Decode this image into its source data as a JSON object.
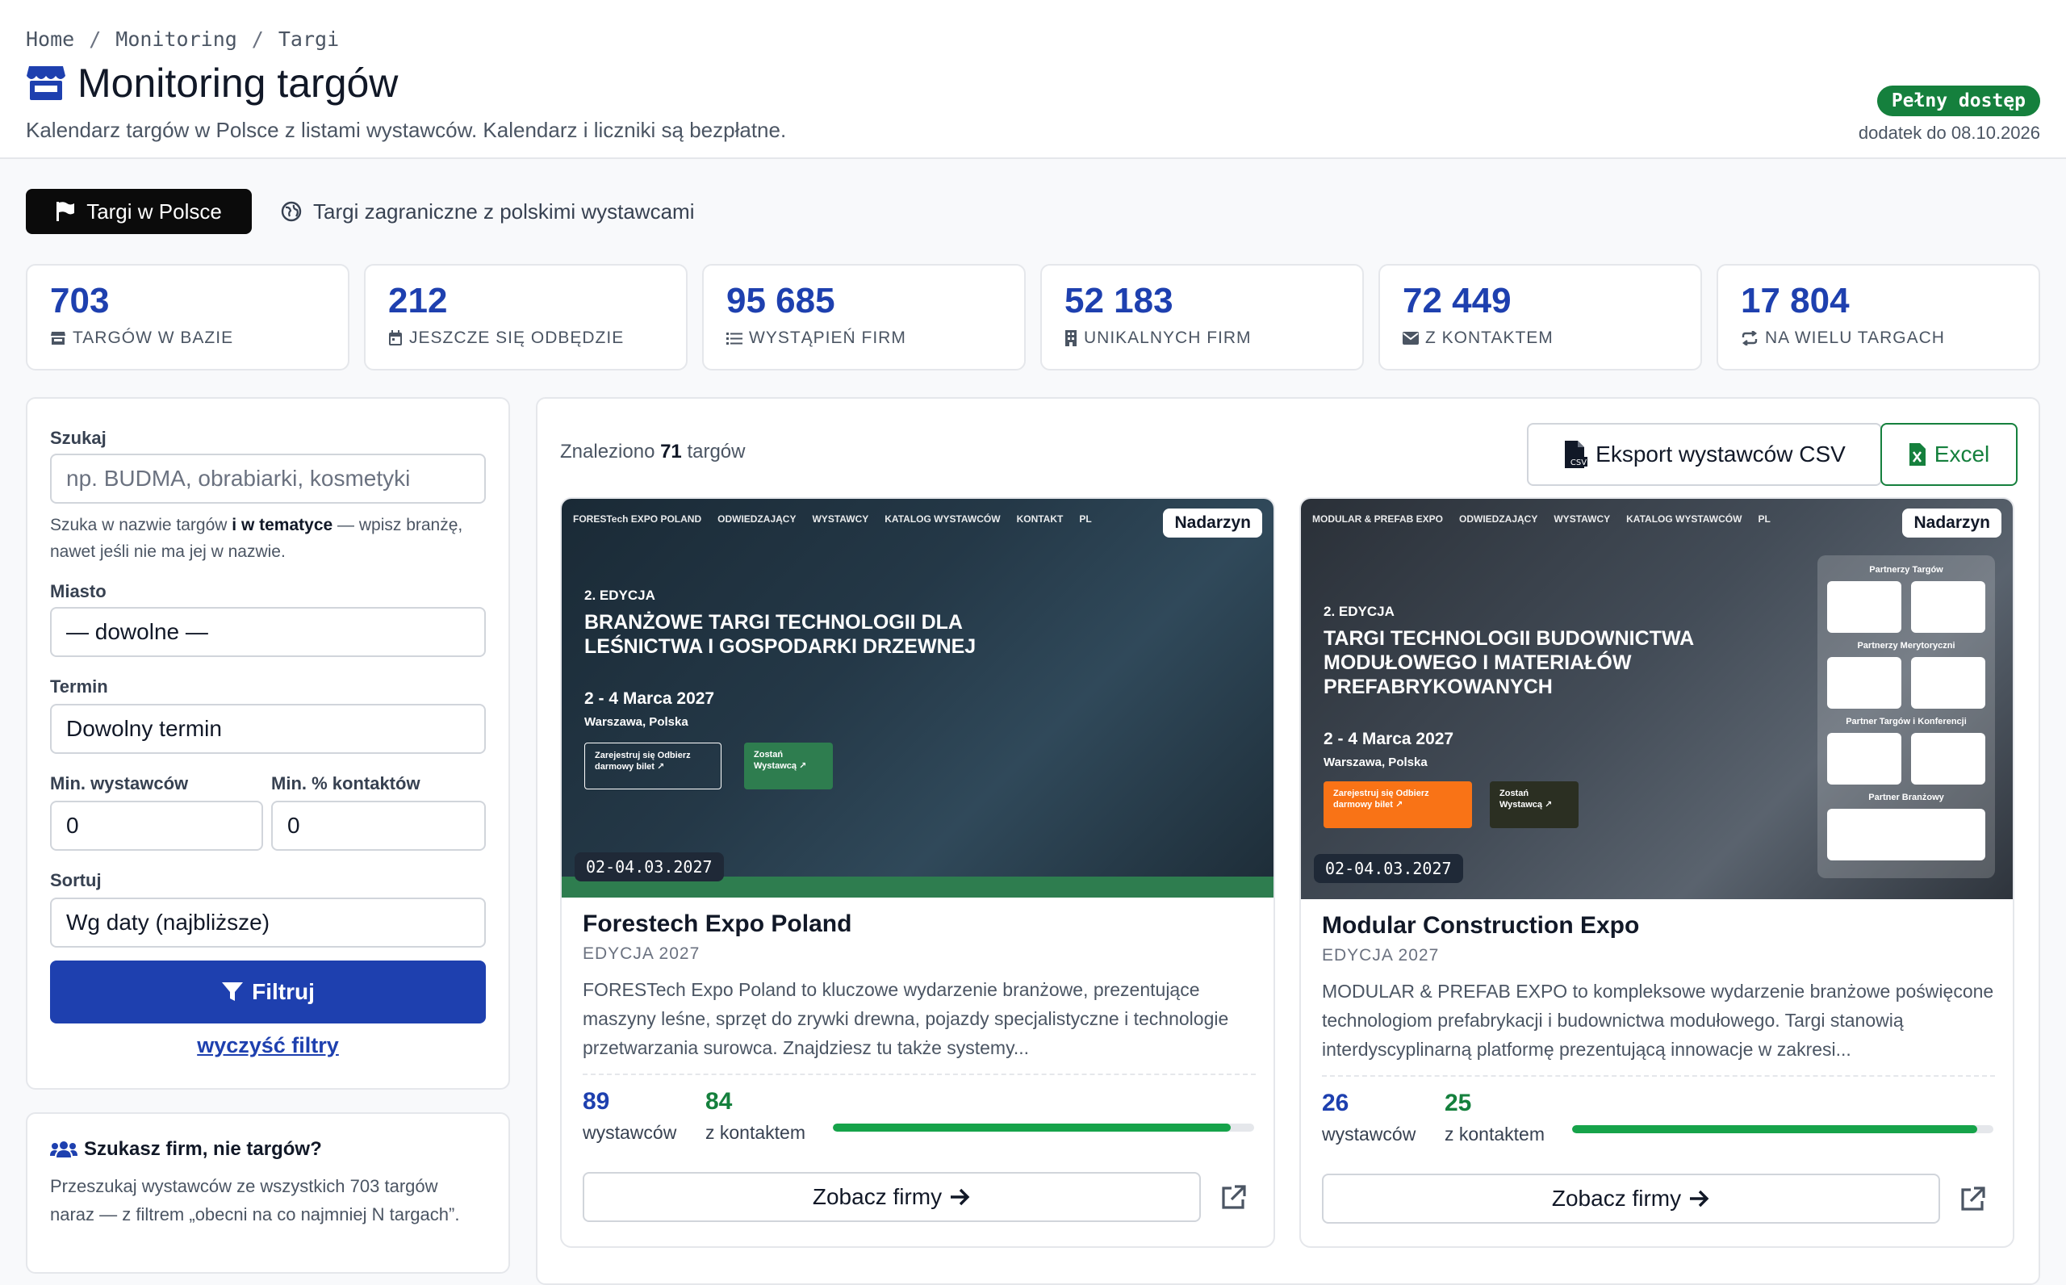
{
  "breadcrumb": [
    "Home",
    "Monitoring",
    "Targi"
  ],
  "header": {
    "title": "Monitoring targów",
    "subtitle": "Kalendarz targów w Polsce z listami wystawców. Kalendarz i liczniki są bezpłatne.",
    "badge": "Pełny dostęp",
    "badge_sub": "dodatek do 08.10.2026"
  },
  "tabs": {
    "active": "Targi w Polsce",
    "other": "Targi zagraniczne z polskimi wystawcami"
  },
  "stats": [
    {
      "value": "703",
      "label": "TARGÓW W BAZIE",
      "icon": "store-icon"
    },
    {
      "value": "212",
      "label": "JESZCZE SIĘ ODBĘDZIE",
      "icon": "calendar-icon"
    },
    {
      "value": "95 685",
      "label": "WYSTĄPIEŃ FIRM",
      "icon": "list-icon"
    },
    {
      "value": "52 183",
      "label": "UNIKALNYCH FIRM",
      "icon": "building-icon"
    },
    {
      "value": "72 449",
      "label": "Z KONTAKTEM",
      "icon": "envelope-icon"
    },
    {
      "value": "17 804",
      "label": "NA WIELU TARGACH",
      "icon": "repeat-icon"
    }
  ],
  "filters": {
    "search_label": "Szukaj",
    "search_placeholder": "np. BUDMA, obrabiarki, kosmetyki",
    "search_hint_1": "Szuka w nazwie targów ",
    "search_hint_bold": "i w tematyce",
    "search_hint_2": " — wpisz branżę, nawet jeśli nie ma jej w nazwie.",
    "city_label": "Miasto",
    "city_value": "— dowolne —",
    "term_label": "Termin",
    "term_value": "Dowolny termin",
    "min_exh_label": "Min. wystawców",
    "min_exh_value": "0",
    "min_contact_label": "Min. % kontaktów",
    "min_contact_value": "0",
    "sort_label": "Sortuj",
    "sort_value": "Wg daty (najbliższe)",
    "filter_button": "Filtruj",
    "clear_link": "wyczyść filtry"
  },
  "promo": {
    "title": "Szukasz firm, nie targów?",
    "text": "Przeszukaj wystawców ze wszystkich 703 targów naraz — z filtrem „obecni na co najmniej N targach”."
  },
  "results": {
    "found_prefix": "Znaleziono ",
    "found_count": "71",
    "found_suffix": " targów",
    "csv_button": "Eksport wystawców CSV",
    "excel_button": "Excel"
  },
  "cards": [
    {
      "city": "Nadarzyn",
      "date": "02-04.03.2027",
      "title": "Forestech Expo Poland",
      "edition": "EDYCJA 2027",
      "description": "FORESTech Expo Poland to kluczowe wydarzenie branżowe, prezentujące maszyny leśne, sprzęt do zrywki drewna, pojazdy specjalistyczne i technologie przetwarzania surowca. Znajdziesz tu także systemy...",
      "exhibitors": "89",
      "exhibitors_label": "wystawców",
      "contacts": "84",
      "contacts_label": "z kontaktem",
      "contact_fraction": 0.944,
      "button": "Zobacz firmy",
      "cover": {
        "nav_logo": "FORESTech EXPO POLAND",
        "nav": [
          "ODWIEDZAJĄCY",
          "WYSTAWCY",
          "KATALOG WYSTAWCÓW",
          "KONTAKT",
          "PL"
        ],
        "edition": "2. EDYCJA",
        "headline": "BRANŻOWE TARGI TECHNOLOGII DLA LEŚNICTWA I GOSPODARKI DRZEWNEJ",
        "date": "2 - 4 Marca 2027",
        "place": "Warszawa, Polska",
        "btn1": "Zarejestruj się Odbierz darmowy bilet ↗",
        "btn2": "Zostań Wystawcą ↗"
      }
    },
    {
      "city": "Nadarzyn",
      "date": "02-04.03.2027",
      "title": "Modular Construction Expo",
      "edition": "EDYCJA 2027",
      "description": "MODULAR & PREFAB EXPO to kompleksowe wydarzenie branżowe poświęcone technologiom prefabrykacji i budownictwa modułowego. Targi stanowią interdyscyplinarną platformę prezentującą innowacje w zakresi...",
      "exhibitors": "26",
      "exhibitors_label": "wystawców",
      "contacts": "25",
      "contacts_label": "z kontaktem",
      "contact_fraction": 0.962,
      "button": "Zobacz firmy",
      "cover": {
        "nav_logo": "MODULAR & PREFAB EXPO",
        "nav": [
          "ODWIEDZAJĄCY",
          "WYSTAWCY",
          "KATALOG WYSTAWCÓW",
          "PL"
        ],
        "edition": "2. EDYCJA",
        "headline": "TARGI TECHNOLOGII BUDOWNICTWA MODUŁOWEGO I MATERIAŁÓW PREFABRYKOWANYCH",
        "date": "2 - 4 Marca 2027",
        "place": "Warszawa, Polska",
        "btn1": "Zarejestruj się Odbierz darmowy bilet ↗",
        "btn2": "Zostań Wystawcą ↗",
        "partner_labels": [
          "Partnerzy Targów",
          "Partnerzy Merytoryczni",
          "Partner Targów i Konferencji",
          "Partner Branżowy"
        ]
      }
    }
  ],
  "colors": {
    "primary": "#1e40af",
    "success": "#15803d",
    "dark": "#0b0b0b"
  }
}
